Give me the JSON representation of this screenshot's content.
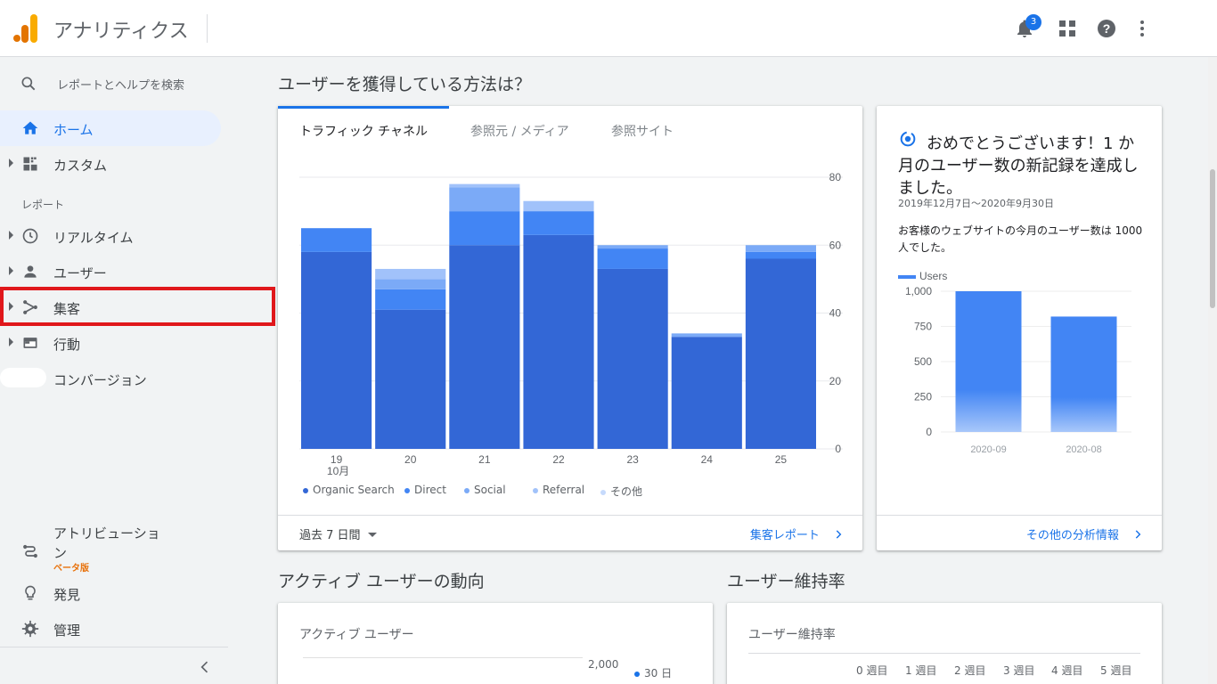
{
  "app": {
    "title": "アナリティクス",
    "notification_count": "3"
  },
  "sidebar": {
    "search_label": "レポートとヘルプを検索",
    "home": "ホーム",
    "custom": "カスタム",
    "reports_section": "レポート",
    "realtime": "リアルタイム",
    "audience": "ユーザー",
    "acquisition": "集客",
    "behavior": "行動",
    "conversions": "コンバージョン",
    "attribution": "アトリビューション",
    "beta": "ベータ版",
    "discover": "発見",
    "admin": "管理"
  },
  "acquisition_card": {
    "heading": "ユーザーを獲得している方法は？",
    "tabs": [
      "トラフィック チャネル",
      "参照元 / メディア",
      "参照サイト"
    ],
    "period": "過去 7 日間",
    "report_link": "集客レポート"
  },
  "insight_card": {
    "title": "おめでとうございます！1 か月のユーザー数の新記録を達成しました。",
    "date_range": "2019年12月7日～2020年9月30日",
    "text": "お客様のウェブサイトの今月のユーザー数は 1000 人でした。",
    "link": "その他の分析情報"
  },
  "active_users": {
    "heading": "アクティブ ユーザーの動向",
    "card_label": "アクティブ ユーザー",
    "y_tick": "2,000",
    "legend": "30 日"
  },
  "retention": {
    "heading": "ユーザー維持率",
    "card_label": "ユーザー維持率",
    "weeks": [
      "0 週目",
      "1 週目",
      "2 週目",
      "3 週目",
      "4 週目",
      "5 週目"
    ]
  },
  "chart_data": [
    {
      "type": "bar",
      "stacked": true,
      "categories": [
        "19",
        "20",
        "21",
        "22",
        "23",
        "24",
        "25"
      ],
      "x_sublabel": "10月",
      "series": [
        {
          "name": "Organic Search",
          "color": "#3367d6",
          "values": [
            58,
            41,
            60,
            63,
            53,
            33,
            56
          ]
        },
        {
          "name": "Direct",
          "color": "#4285f4",
          "values": [
            7,
            6,
            10,
            7,
            6,
            0,
            2
          ]
        },
        {
          "name": "Social",
          "color": "#7baaf7",
          "values": [
            0,
            3,
            7,
            0,
            1,
            1,
            2
          ]
        },
        {
          "name": "Referral",
          "color": "#a1c2fa",
          "values": [
            0,
            3,
            1,
            3,
            0,
            0,
            0
          ]
        },
        {
          "name": "その他",
          "color": "#c6dafc",
          "values": [
            0,
            0,
            0,
            0,
            0,
            0,
            0
          ]
        }
      ],
      "y_ticks": [
        "0",
        "20",
        "40",
        "60",
        "80"
      ],
      "ylim": [
        0,
        80
      ],
      "legend_position": "bottom"
    },
    {
      "type": "bar",
      "categories": [
        "2020-09",
        "2020-08"
      ],
      "series": [
        {
          "name": "Users",
          "color": "#4285f4",
          "values": [
            1000,
            820
          ]
        }
      ],
      "y_ticks": [
        "0",
        "250",
        "500",
        "750",
        "1,000"
      ],
      "ylim": [
        0,
        1000
      ],
      "legend_position": "top-left"
    }
  ]
}
